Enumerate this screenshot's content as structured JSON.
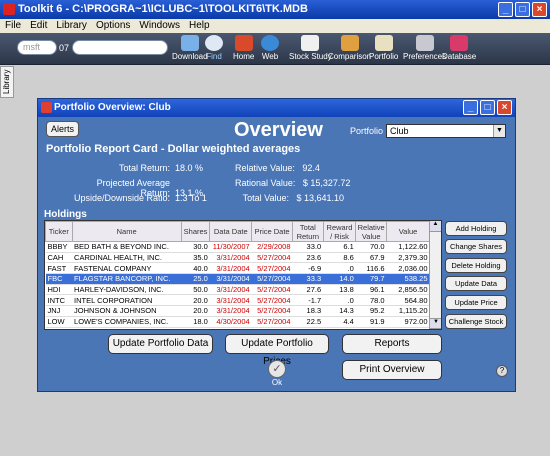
{
  "app": {
    "title": "Toolkit 6 - C:\\PROGRA~1\\ICLUBC~1\\TOOLKIT6\\TK.MDB"
  },
  "menu": [
    "File",
    "Edit",
    "Library",
    "Options",
    "Windows",
    "Help"
  ],
  "toolbar": {
    "search_placeholder": "msft",
    "sep": "07",
    "tools": [
      "Download",
      "Find",
      "Home",
      "Web",
      "Stock Study",
      "Comparison",
      "Portfolio",
      "Preferences",
      "Database"
    ]
  },
  "sidebar": {
    "library": "Library"
  },
  "window": {
    "title": "Portfolio Overview: Club",
    "alerts": "Alerts",
    "heading": "Overview",
    "portfolio_label": "Portfolio",
    "portfolio_value": "Club",
    "report_title": "Portfolio Report Card - Dollar weighted averages"
  },
  "stats": {
    "total_return_k": "Total Return:",
    "total_return_v": "18.0 %",
    "proj_avg_k": "Projected Average Return:",
    "proj_avg_v": "13.1 %",
    "updown_k": "Upside/Downside Ratio:",
    "updown_v": "1.3 To 1",
    "relval_k": "Relative Value:",
    "relval_v": "92.4",
    "ratval_k": "Rational Value:",
    "ratval_v": "$ 15,327.72",
    "totval_k": "Total Value:",
    "totval_v": "$ 13,641.10"
  },
  "holdings": {
    "label": "Holdings",
    "columns": [
      "Ticker",
      "Name",
      "Shares",
      "Data Date",
      "Price Date",
      "Total Return",
      "Reward / Risk",
      "Relative Value",
      "Value"
    ],
    "rows": [
      [
        "BBBY",
        "BED BATH & BEYOND INC.",
        "30.0",
        "11/30/2007",
        "2/29/2008",
        "33.0",
        "6.1",
        "70.0",
        "1,122.60"
      ],
      [
        "CAH",
        "CARDINAL HEALTH, INC.",
        "35.0",
        "3/31/2004",
        "5/27/2004",
        "23.6",
        "8.6",
        "67.9",
        "2,379.30"
      ],
      [
        "FAST",
        "FASTENAL COMPANY",
        "40.0",
        "3/31/2004",
        "5/27/2004",
        "-6.9",
        ".0",
        "116.6",
        "2,036.00"
      ],
      [
        "FBC",
        "FLAGSTAR BANCORP, INC.",
        "25.0",
        "3/31/2004",
        "5/27/2004",
        "33.3",
        "14.0",
        "79.7",
        "538.25"
      ],
      [
        "HDI",
        "HARLEY-DAVIDSON, INC.",
        "50.0",
        "3/31/2004",
        "5/27/2004",
        "27.6",
        "13.8",
        "96.1",
        "2,856.50"
      ],
      [
        "INTC",
        "INTEL CORPORATION",
        "20.0",
        "3/31/2004",
        "5/27/2004",
        "-1.7",
        ".0",
        "78.0",
        "564.80"
      ],
      [
        "JNJ",
        "JOHNSON & JOHNSON",
        "20.0",
        "3/31/2004",
        "5/27/2004",
        "18.3",
        "14.3",
        "95.2",
        "1,115.20"
      ],
      [
        "LOW",
        "LOWE'S COMPANIES, INC.",
        "18.0",
        "4/30/2004",
        "5/27/2004",
        "22.5",
        "4.4",
        "91.9",
        "972.00"
      ]
    ]
  },
  "actions": {
    "add": "Add Holding",
    "change": "Change Shares",
    "delete": "Delete Holding",
    "update": "Update Data",
    "price": "Update Price",
    "challenge": "Challenge Stock",
    "upd_portfolio_data": "Update Portfolio Data",
    "upd_portfolio_prices": "Update Portfolio Prices",
    "reports": "Reports",
    "print": "Print Overview",
    "ok": "Ok",
    "help": "?"
  }
}
